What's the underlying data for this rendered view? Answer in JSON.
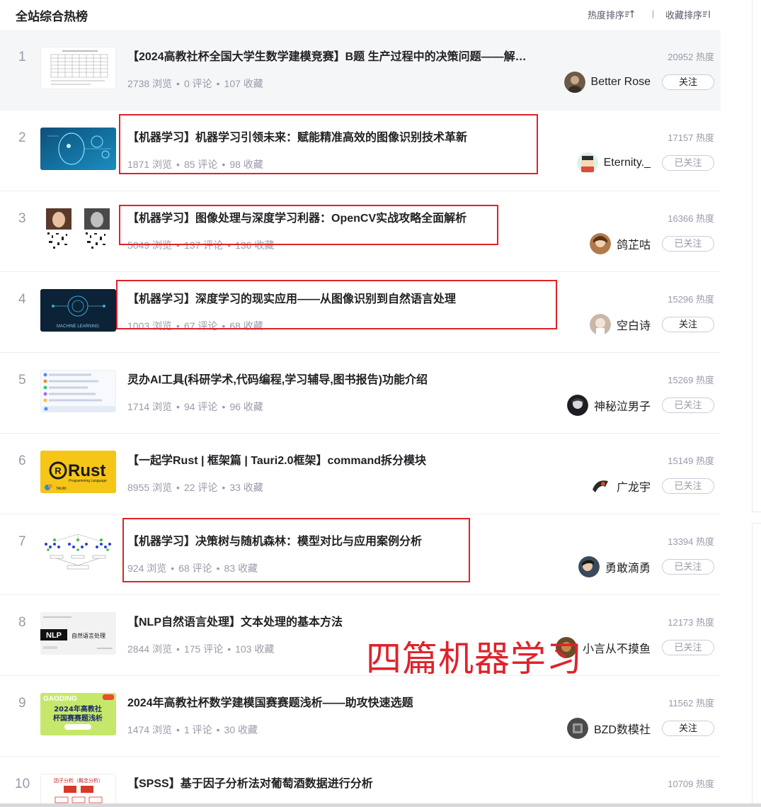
{
  "header": {
    "title": "全站综合热榜",
    "sort_hot": "热度排序",
    "sort_hot_icon": "sort-ascending-icon",
    "sort_separator": "|",
    "sort_fav": "收藏排序",
    "sort_fav_icon": "sort-lines-icon"
  },
  "items": [
    {
      "rank": "1",
      "title": "【2024高教社杯全国大学生数学建模竞赛】B题 生产过程中的决策问题——解…",
      "views": "2738 浏览",
      "comments": "0 评论",
      "favorites": "107 收藏",
      "heat": "20952 热度",
      "author": "Better Rose",
      "follow": "关注",
      "followed": false
    },
    {
      "rank": "2",
      "title": "【机器学习】机器学习引领未来：赋能精准高效的图像识别技术革新",
      "views": "1871 浏览",
      "comments": "85 评论",
      "favorites": "98 收藏",
      "heat": "17157 热度",
      "author": "Eternity._",
      "follow": "已关注",
      "followed": true
    },
    {
      "rank": "3",
      "title": "【机器学习】图像处理与深度学习利器：OpenCV实战攻略全面解析",
      "views": "5049 浏览",
      "comments": "137 评论",
      "favorites": "136 收藏",
      "heat": "16366 热度",
      "author": "鸽芷咕",
      "follow": "已关注",
      "followed": true
    },
    {
      "rank": "4",
      "title": "【机器学习】深度学习的现实应用——从图像识别到自然语言处理",
      "views": "1003 浏览",
      "comments": "67 评论",
      "favorites": "68 收藏",
      "heat": "15296 热度",
      "author": "空白诗",
      "follow": "关注",
      "followed": false
    },
    {
      "rank": "5",
      "title": "灵办AI工具(科研学术,代码编程,学习辅导,图书报告)功能介绍",
      "views": "1714 浏览",
      "comments": "94 评论",
      "favorites": "96 收藏",
      "heat": "15269 热度",
      "author": "神秘泣男子",
      "follow": "已关注",
      "followed": true
    },
    {
      "rank": "6",
      "title": "【一起学Rust | 框架篇 | Tauri2.0框架】command拆分模块",
      "views": "8955 浏览",
      "comments": "22 评论",
      "favorites": "33 收藏",
      "heat": "15149 热度",
      "author": "广龙宇",
      "follow": "已关注",
      "followed": true
    },
    {
      "rank": "7",
      "title": "【机器学习】决策树与随机森林：模型对比与应用案例分析",
      "views": "924 浏览",
      "comments": "68 评论",
      "favorites": "83 收藏",
      "heat": "13394 热度",
      "author": "勇敢滴勇",
      "follow": "已关注",
      "followed": true
    },
    {
      "rank": "8",
      "title": "【NLP自然语言处理】文本处理的基本方法",
      "views": "2844 浏览",
      "comments": "175 评论",
      "favorites": "103 收藏",
      "heat": "12173 热度",
      "author": "小言从不摸鱼",
      "follow": "已关注",
      "followed": true
    },
    {
      "rank": "9",
      "title": "2024年高教社杯数学建模国赛赛题浅析——助攻快速选题",
      "views": "1474 浏览",
      "comments": "1 评论",
      "favorites": "30 收藏",
      "heat": "11562 热度",
      "author": "BZD数模社",
      "follow": "关注",
      "followed": false
    },
    {
      "rank": "10",
      "title": "【SPSS】基于因子分析法对葡萄酒数据进行分析",
      "views": "",
      "comments": "",
      "favorites": "",
      "heat": "10709 热度",
      "author": "",
      "follow": "",
      "followed": false
    }
  ],
  "thumb_texts": {
    "rust": "Rust",
    "rust_sub": "Programming Language",
    "tauri": "TAURI",
    "nlp": "NLP",
    "nlp_sub": "自然语言处理",
    "ml": "MACHINE LEARNING",
    "banner_top": "GAODING",
    "banner_line1": "2024年高教社",
    "banner_line2": "杯国赛赛题浅析",
    "spss": "因子分析（概念分析）"
  },
  "annotation": {
    "text": "四篇机器学习",
    "color": "#e0222b"
  },
  "colors": {
    "accent_red": "#e0222b",
    "muted": "#999aaa",
    "text": "#222226",
    "first_row_bg": "#f5f6f7"
  }
}
